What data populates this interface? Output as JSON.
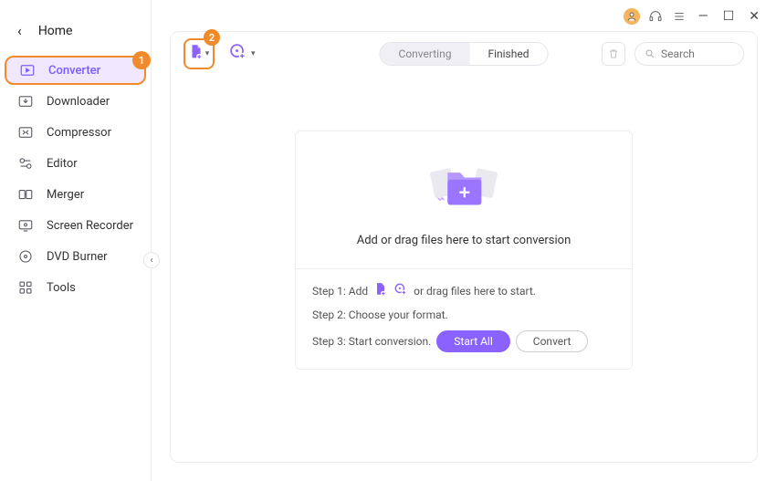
{
  "colors": {
    "accent": "#8a62ff",
    "callout": "#f08a2a"
  },
  "sidebar": {
    "back_label": "Home",
    "items": [
      {
        "label": "Converter"
      },
      {
        "label": "Downloader"
      },
      {
        "label": "Compressor"
      },
      {
        "label": "Editor"
      },
      {
        "label": "Merger"
      },
      {
        "label": "Screen Recorder"
      },
      {
        "label": "DVD Burner"
      },
      {
        "label": "Tools"
      }
    ]
  },
  "callouts": {
    "one": "1",
    "two": "2"
  },
  "toolbar": {
    "tabs": {
      "converting": "Converting",
      "finished": "Finished"
    },
    "search_placeholder": "Search"
  },
  "drop": {
    "caption": "Add or drag files here to start conversion"
  },
  "steps": {
    "s1_pre": "Step 1: Add",
    "s1_post": "or drag files here to start.",
    "s2": "Step 2: Choose your format.",
    "s3": "Step 3: Start conversion.",
    "start_all": "Start All",
    "convert": "Convert"
  }
}
